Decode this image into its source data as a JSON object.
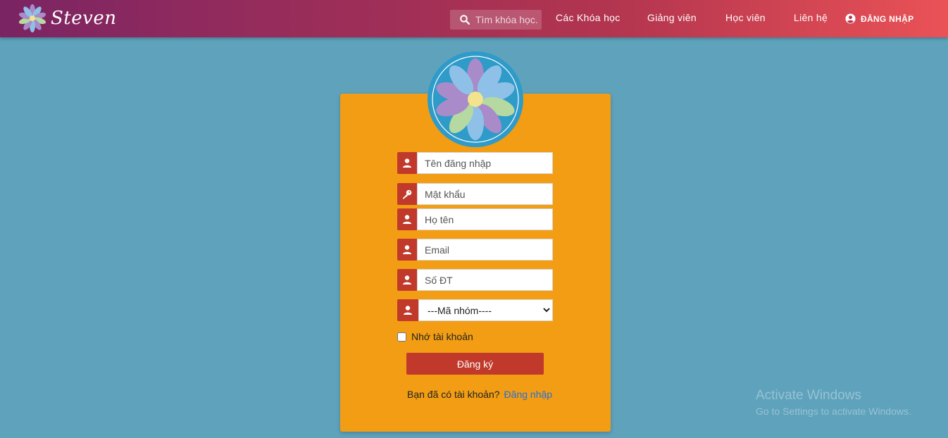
{
  "header": {
    "brand": "Steven",
    "search_placeholder": "Tìm khóa học...",
    "nav": [
      "Các Khóa học",
      "Giảng viên",
      "Học viên",
      "Liên hệ"
    ],
    "login_label": "ĐĂNG NHẬP"
  },
  "form": {
    "username_placeholder": "Tên đăng nhập",
    "password_placeholder": "Mật khẩu",
    "fullname_placeholder": "Họ tên",
    "email_placeholder": "Email",
    "phone_placeholder": "Số ĐT",
    "group_select_value": "---Mã nhóm----",
    "remember_label": "Nhớ tài khoản",
    "submit_label": "Đăng ký",
    "have_account_text": "Bạn đã có tài khoản?",
    "login_link": "Đăng nhập"
  },
  "watermark": {
    "title": "Activate Windows",
    "subtitle": "Go to Settings to activate Windows."
  },
  "colors": {
    "page_bg": "#5fa2bc",
    "card_bg": "#f29d13",
    "accent_red": "#c0392b",
    "link_blue": "#2a6fd6"
  },
  "icons": [
    "flower-logo-icon",
    "search-icon",
    "account-circle-icon",
    "user-icon",
    "key-icon"
  ]
}
